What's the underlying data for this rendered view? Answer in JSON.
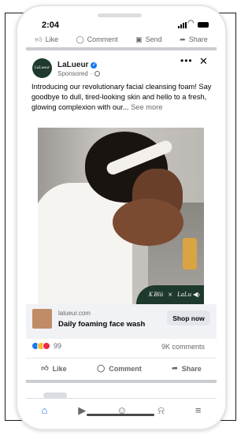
{
  "status_bar": {
    "time": "2:04"
  },
  "prev_post_actions": {
    "like": "Like",
    "comment": "Comment",
    "send": "Send",
    "share": "Share"
  },
  "post": {
    "page_name": "LaLueur",
    "avatar_text": "LaLueur",
    "sponsored": "Sponsored",
    "text": "Introducing our revolutionary facial cleansing foam! Say goodbye to dull, tired-looking skin and hello to a fresh, glowing complexion with our...",
    "see_more": "See more",
    "media_overlay": {
      "script": "K Blü",
      "separator": "×",
      "brand": "LaLu"
    },
    "link": {
      "domain": "lalueur.com",
      "headline": "Daily foaming face wash",
      "cta": "Shop now"
    },
    "reactions_count": "99",
    "comments_count": "9K comments",
    "actions": {
      "like": "Like",
      "comment": "Comment",
      "share": "Share"
    }
  },
  "icons": {
    "prev": [
      "like-icon",
      "comment-icon",
      "send-icon",
      "share-icon"
    ],
    "nav": [
      "home-icon",
      "video-icon",
      "groups-icon",
      "notifications-icon",
      "menu-icon"
    ]
  },
  "colors": {
    "accent": "#1877f2",
    "brand_green": "#1e3a2c"
  }
}
